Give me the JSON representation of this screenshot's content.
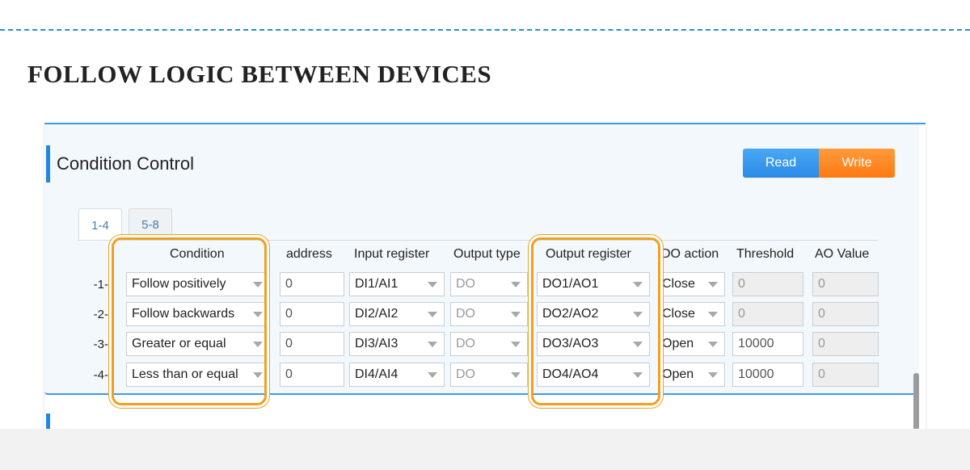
{
  "page": {
    "heading": "FOLLOW LOGIC BETWEEN DEVICES"
  },
  "panel": {
    "title": "Condition Control",
    "read_label": "Read",
    "write_label": "Write",
    "tabs": [
      {
        "label": "1-4",
        "active": true
      },
      {
        "label": "5-8",
        "active": false
      }
    ],
    "columns": [
      "Condition",
      "address",
      "Input register",
      "Output type",
      "Output register",
      "DO action",
      "Threshold",
      "AO Value"
    ],
    "rows": [
      {
        "label": "-1-",
        "condition": "Follow positively",
        "address": "0",
        "input_register": "DI1/AI1",
        "output_type": "DO",
        "output_register": "DO1/AO1",
        "do_action": "Close",
        "threshold": "0",
        "ao_value": "0"
      },
      {
        "label": "-2-",
        "condition": "Follow backwards",
        "address": "0",
        "input_register": "DI2/AI2",
        "output_type": "DO",
        "output_register": "DO2/AO2",
        "do_action": "Close",
        "threshold": "0",
        "ao_value": "0"
      },
      {
        "label": "-3-",
        "condition": "Greater or equal",
        "address": "0",
        "input_register": "DI3/AI3",
        "output_type": "DO",
        "output_register": "DO3/AO3",
        "do_action": "Open",
        "threshold": "10000",
        "ao_value": "0"
      },
      {
        "label": "-4-",
        "condition": "Less than or equal",
        "address": "0",
        "input_register": "DI4/AI4",
        "output_type": "DO",
        "output_register": "DO4/AO4",
        "do_action": "Open",
        "threshold": "10000",
        "ao_value": "0"
      }
    ]
  },
  "colors": {
    "accent_blue": "#1e88e5",
    "read_button": "#2a8ae6",
    "write_button": "#ff7a12",
    "highlight": "#f0a020",
    "dashed_line": "#2a8fc4"
  }
}
